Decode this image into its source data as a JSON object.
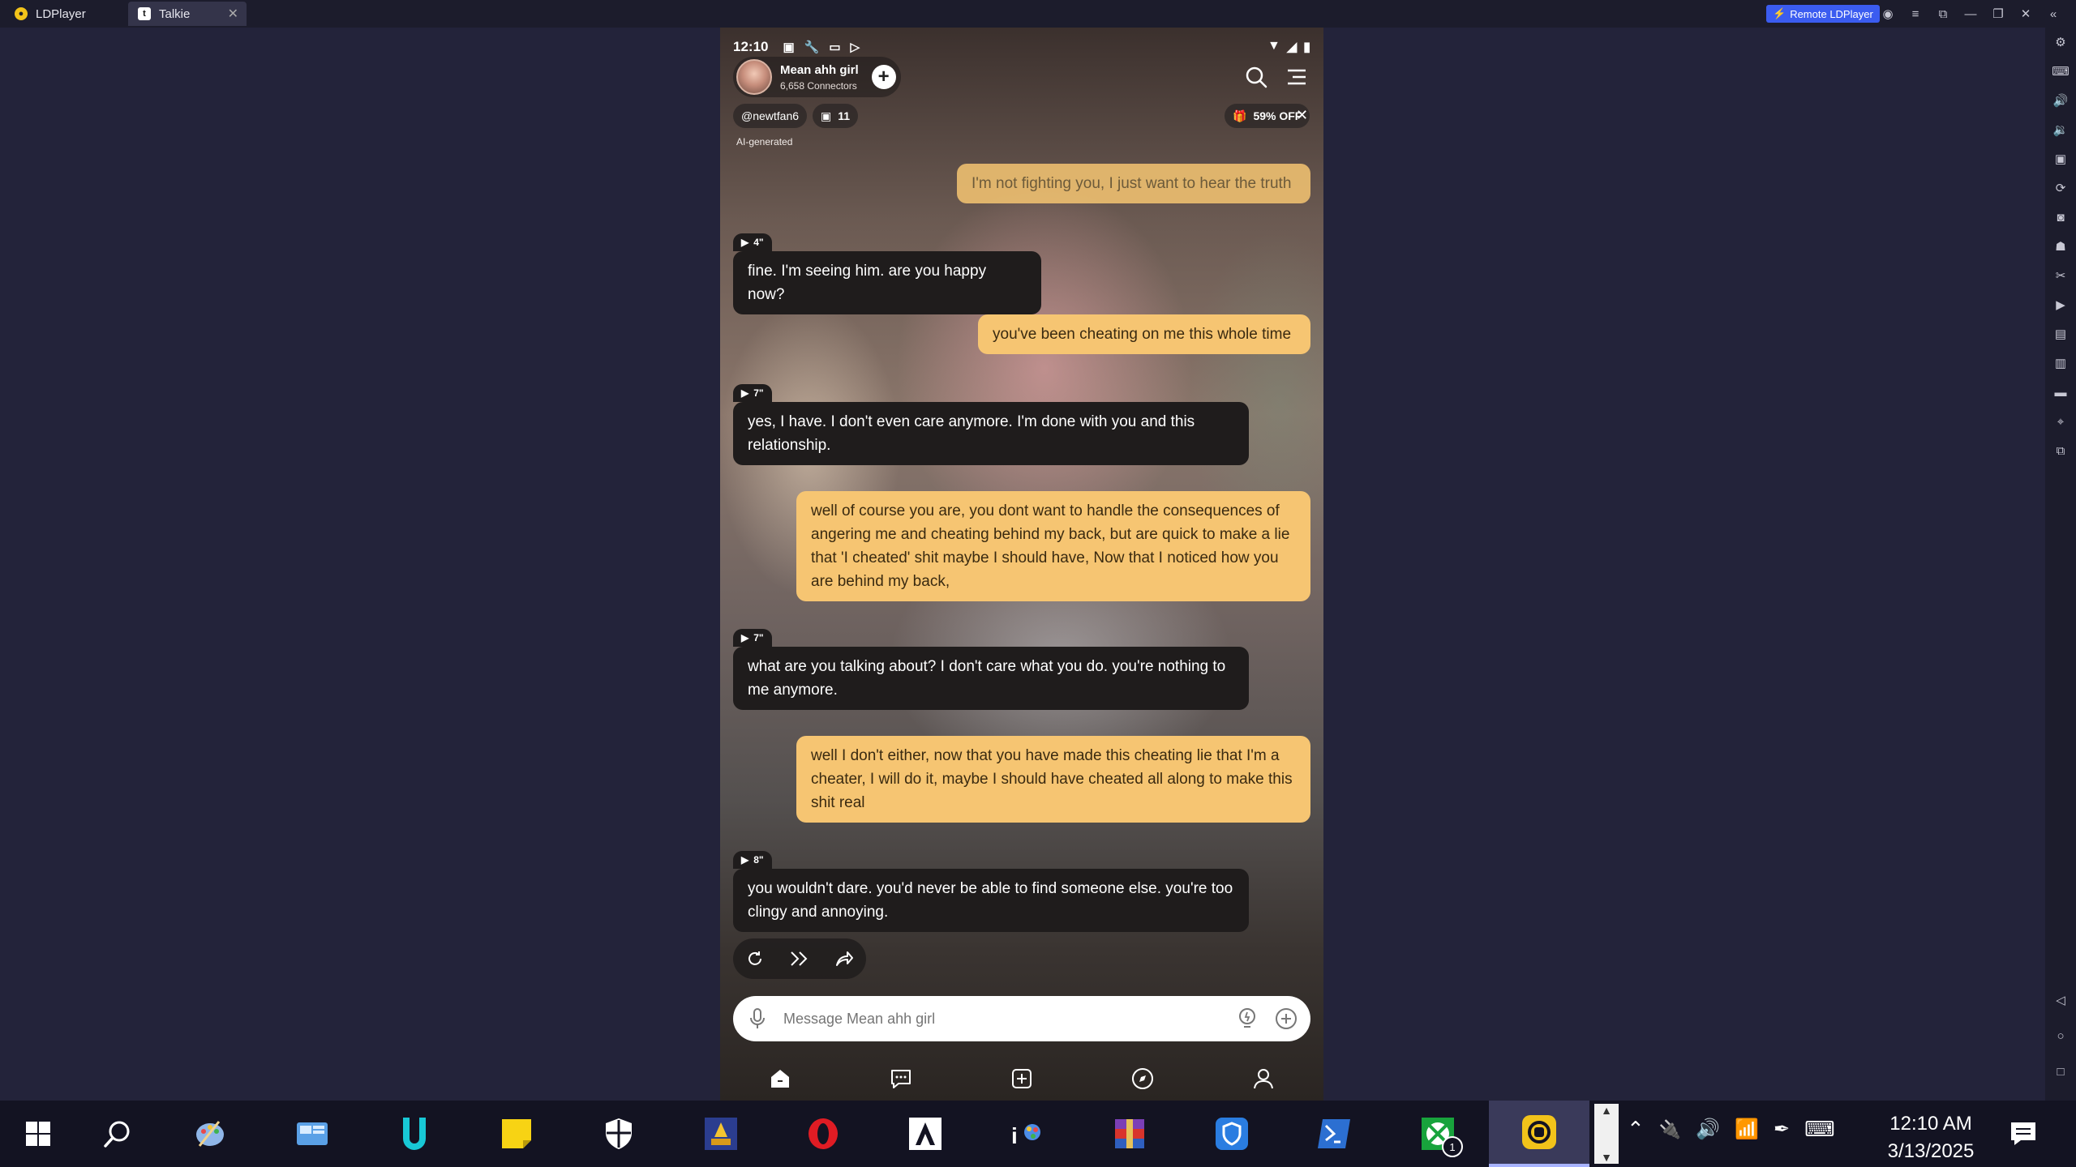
{
  "titlebar": {
    "app_tab": "LDPlayer",
    "active_tab": "Talkie",
    "remote_button": "Remote LDPlayer"
  },
  "status": {
    "time": "12:10"
  },
  "header": {
    "character_name": "Mean ahh girl",
    "connectors": "6,658 Connectors"
  },
  "subrow": {
    "creator": "@newtfan6",
    "memories_count": "11",
    "discount": "59% OFF",
    "ai_label": "AI-generated"
  },
  "messages": [
    {
      "role": "user",
      "text": "I'm not fighting you, I just want to hear the truth"
    },
    {
      "role": "bot",
      "duration": "4\"",
      "text": "fine. I'm seeing him. are you happy now?"
    },
    {
      "role": "user",
      "text": "you've been cheating on me this whole time"
    },
    {
      "role": "bot",
      "duration": "7\"",
      "text": "yes, I have. I don't even care anymore. I'm done with you and this relationship."
    },
    {
      "role": "user",
      "text": "well of course you are, you dont want to handle the consequences of angering me and cheating behind my back, but are quick to make a lie that 'I cheated' shit maybe I should have, Now that I noticed how you are behind my back,"
    },
    {
      "role": "bot",
      "duration": "7\"",
      "text": "what are you talking about? I don't care what you do. you're nothing to me anymore."
    },
    {
      "role": "user",
      "text": "well I don't either, now that you have made this cheating lie that I'm a cheater, I will do it, maybe I should have cheated all along to make this shit real"
    },
    {
      "role": "bot",
      "duration": "8\"",
      "text": "you wouldn't dare. you'd never be able to find someone else. you're too clingy and annoying."
    }
  ],
  "composer": {
    "placeholder": "Message Mean ahh girl"
  },
  "taskbar": {
    "clock_time": "12:10 AM",
    "clock_date": "3/13/2025",
    "xbox_badge": "1"
  },
  "colors": {
    "user_bubble": "#f6c572",
    "bot_bubble": "#1f1c1c",
    "desktop_bg": "#23233a",
    "remote_btn": "#3b5cf0"
  }
}
